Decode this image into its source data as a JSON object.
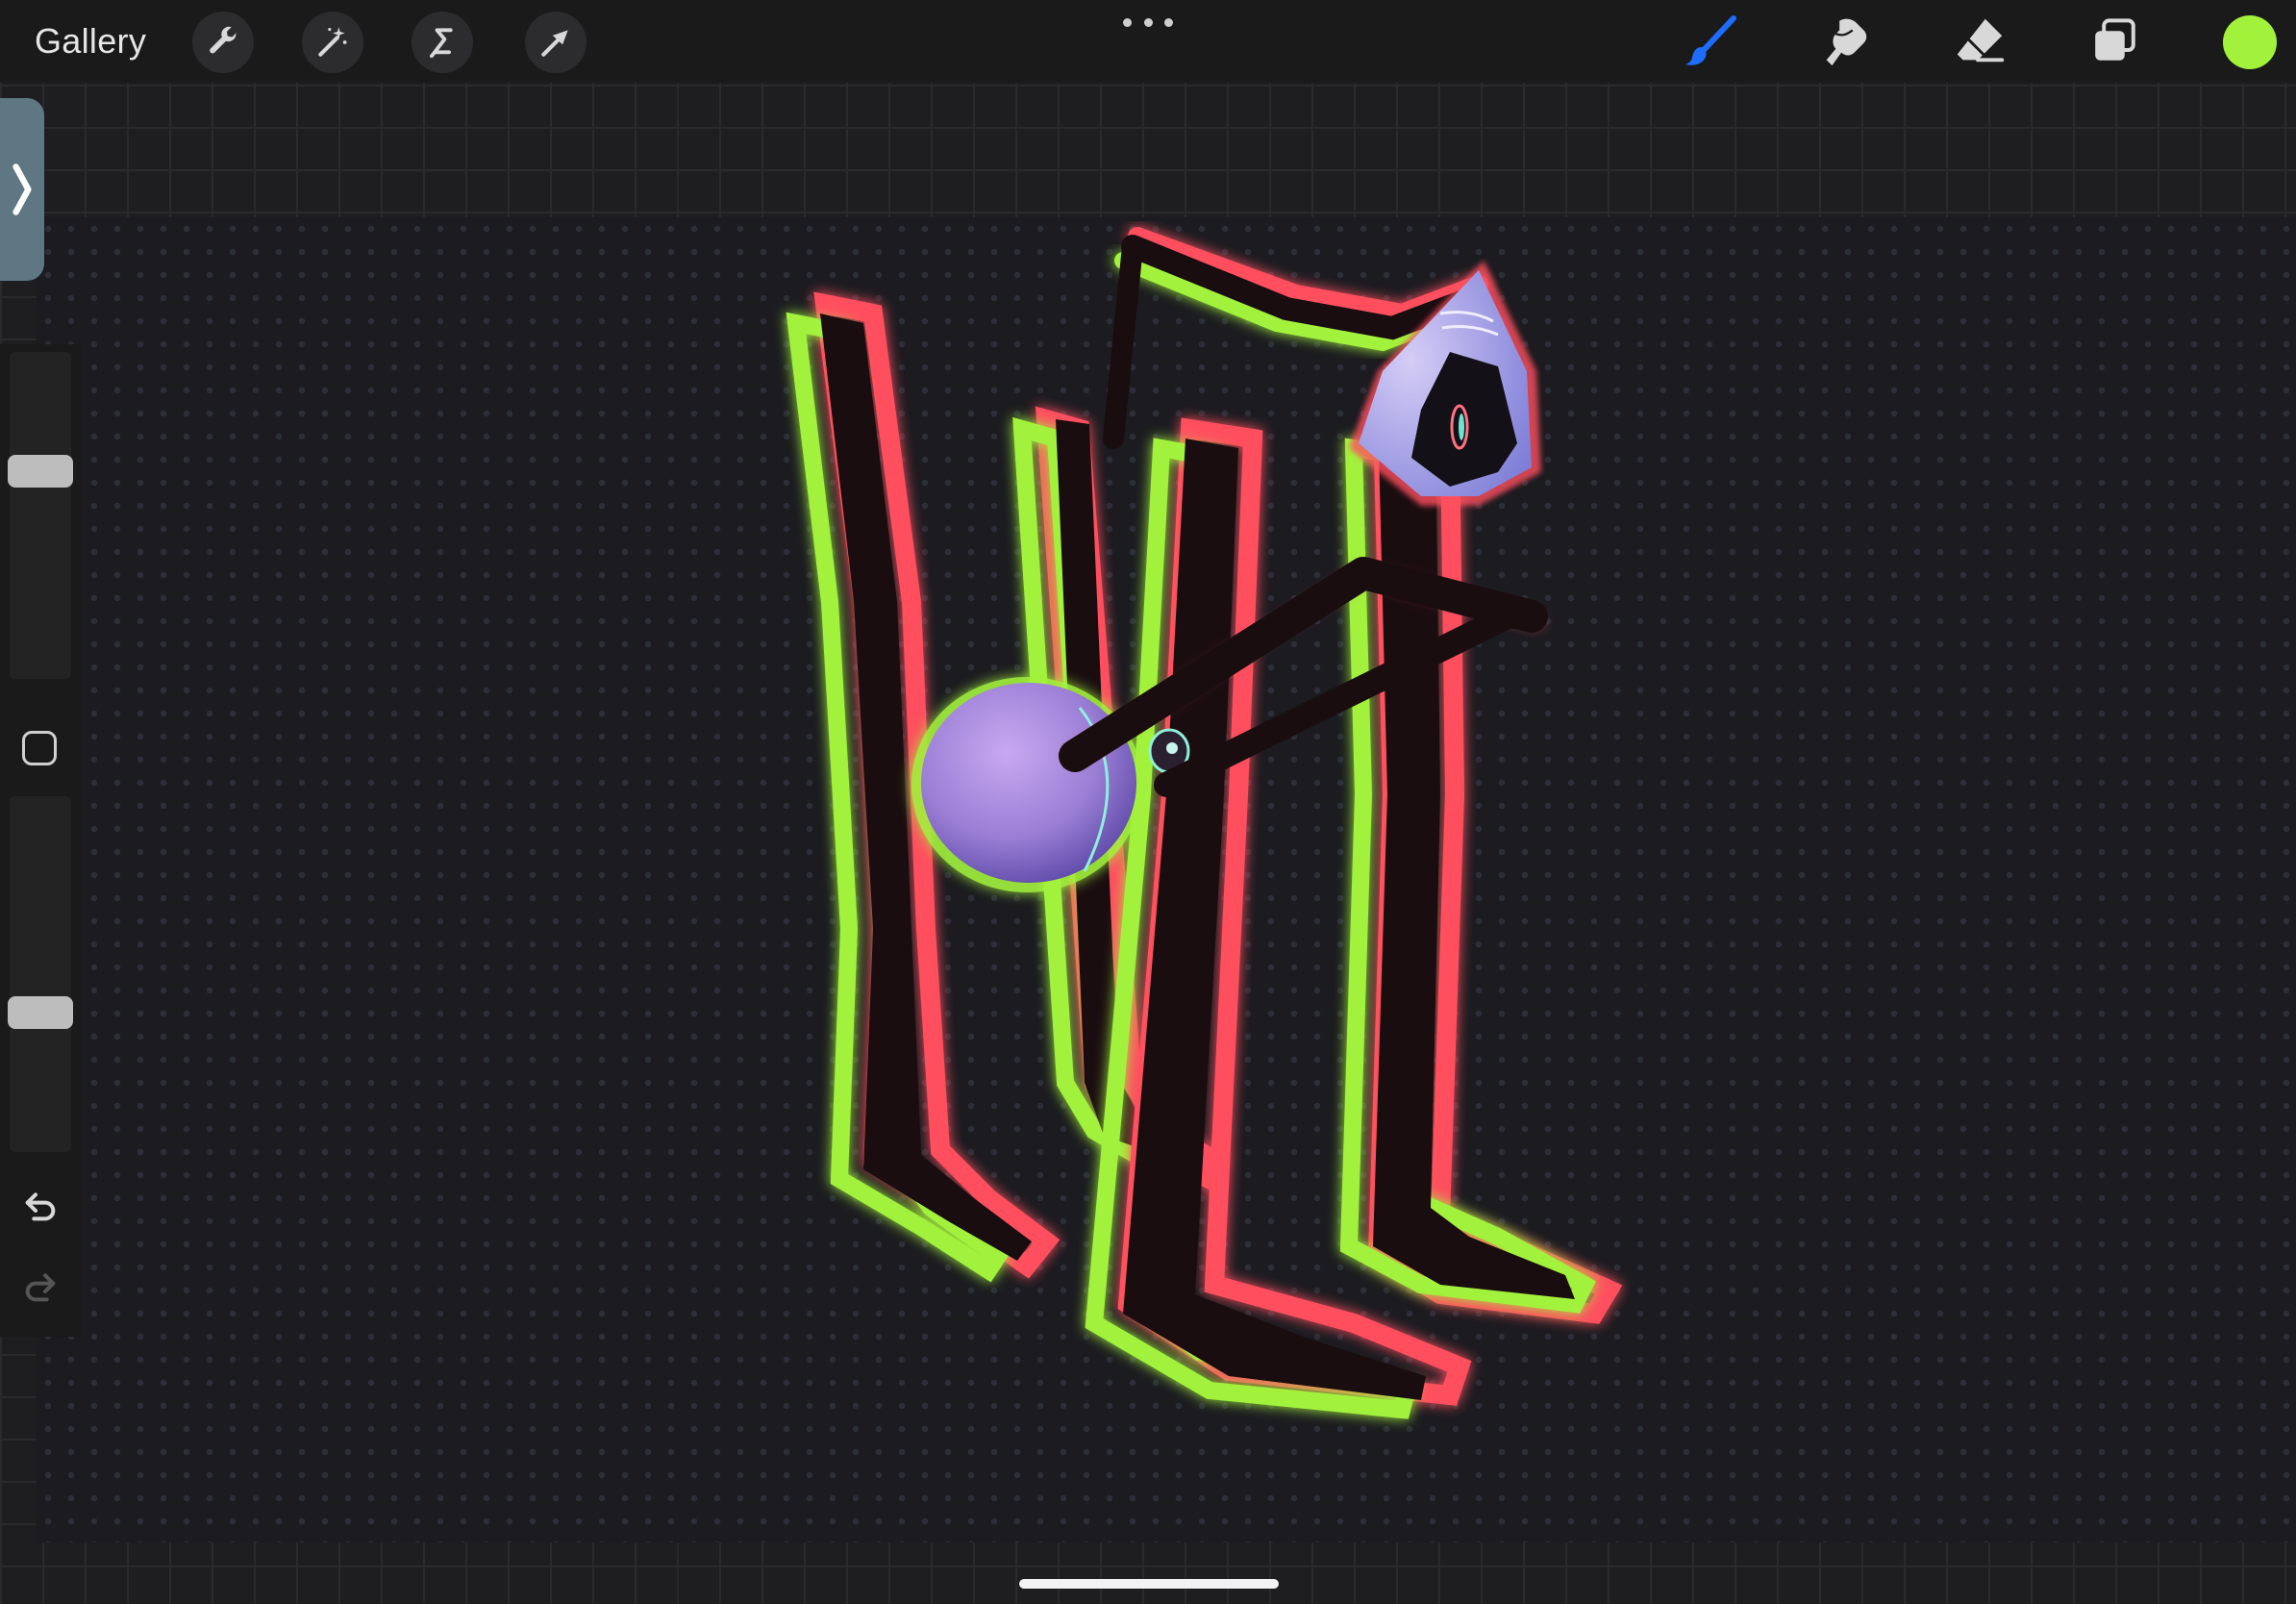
{
  "toolbar": {
    "gallery_label": "Gallery",
    "left_tools": [
      {
        "name": "actions",
        "icon": "wrench-icon"
      },
      {
        "name": "adjustments",
        "icon": "magic-wand-icon"
      },
      {
        "name": "selection",
        "icon": "selection-s-icon"
      },
      {
        "name": "transform",
        "icon": "arrow-cursor-icon"
      }
    ],
    "more_icon": "ellipsis-icon",
    "right_tools": [
      {
        "name": "brush",
        "icon": "brush-icon",
        "active": true
      },
      {
        "name": "smudge",
        "icon": "smudge-finger-icon",
        "active": false
      },
      {
        "name": "eraser",
        "icon": "eraser-icon",
        "active": false
      },
      {
        "name": "layers",
        "icon": "layers-icon",
        "active": false
      }
    ],
    "current_color": "#a2f23c",
    "active_tool_color": "#1f6dff"
  },
  "sidebar": {
    "toggle_icon": "chevron-right-icon",
    "brush_size_level": 0.35,
    "opacity_level": 0.62,
    "modify_icon": "square-modify-icon",
    "undo_icon": "undo-arrow-icon",
    "redo_icon": "redo-arrow-icon",
    "redo_enabled": false
  },
  "canvas": {
    "background_color": "#1b1b20",
    "artwork_description_hidden": true,
    "palette": {
      "glow_green": "#a2f23c",
      "glow_red": "#ff4f5e",
      "leg_dark": "#1a0d10",
      "body_purple": "#a58ad8",
      "head_lavender": "#b9b2ee"
    }
  }
}
